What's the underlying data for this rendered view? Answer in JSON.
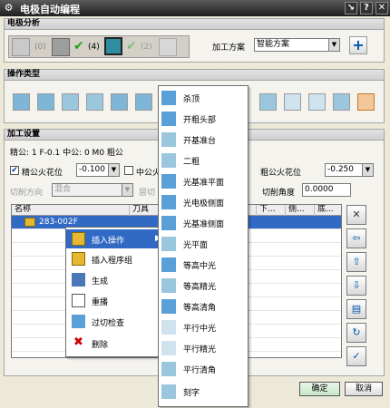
{
  "window": {
    "title": "电极自动编程"
  },
  "electrode_section": {
    "title": "电极分析",
    "counts": [
      "(0)",
      "(4)",
      "(2)"
    ],
    "plan_label": "加工方案",
    "plan_value": "智能方案"
  },
  "op_type_section": {
    "title": "操作类型"
  },
  "settings": {
    "title": "加工设置",
    "tolerances": "精公: 1 F-0.1    中公: 0 M0    粗公",
    "fine_spark_label": "精公火花位",
    "fine_spark_value": "-0.100",
    "mid_spark_label": "中公火",
    "rough_spark_label": "粗公火花位",
    "rough_spark_value": "-0.250",
    "cut_dir_label": "切削方向",
    "cut_dir_value": "混合",
    "cut_angle_label": "切削角度",
    "cut_angle_value": "0.0000"
  },
  "grid": {
    "columns": [
      "名称",
      "刀具",
      "下...",
      "侧...",
      "底..."
    ],
    "rows": [
      {
        "name": "283-002F"
      }
    ]
  },
  "context_menu": {
    "items": [
      "插入操作",
      "插入程序组",
      "生成",
      "重播",
      "过切检查",
      "删除"
    ]
  },
  "submenu": {
    "items": [
      "杀顶",
      "开粗头部",
      "开基准台",
      "二粗",
      "光基准平面",
      "光电极侧面",
      "光基准侧面",
      "光平面",
      "等高中光",
      "等高精光",
      "等高清角",
      "平行中光",
      "平行精光",
      "平行清角",
      "刻字"
    ]
  },
  "buttons": {
    "ok": "确定",
    "cancel": "取消"
  },
  "colors": {
    "accent": "#0a246a",
    "selection": "#316ac5",
    "title_bar": "#1e1e1e"
  }
}
